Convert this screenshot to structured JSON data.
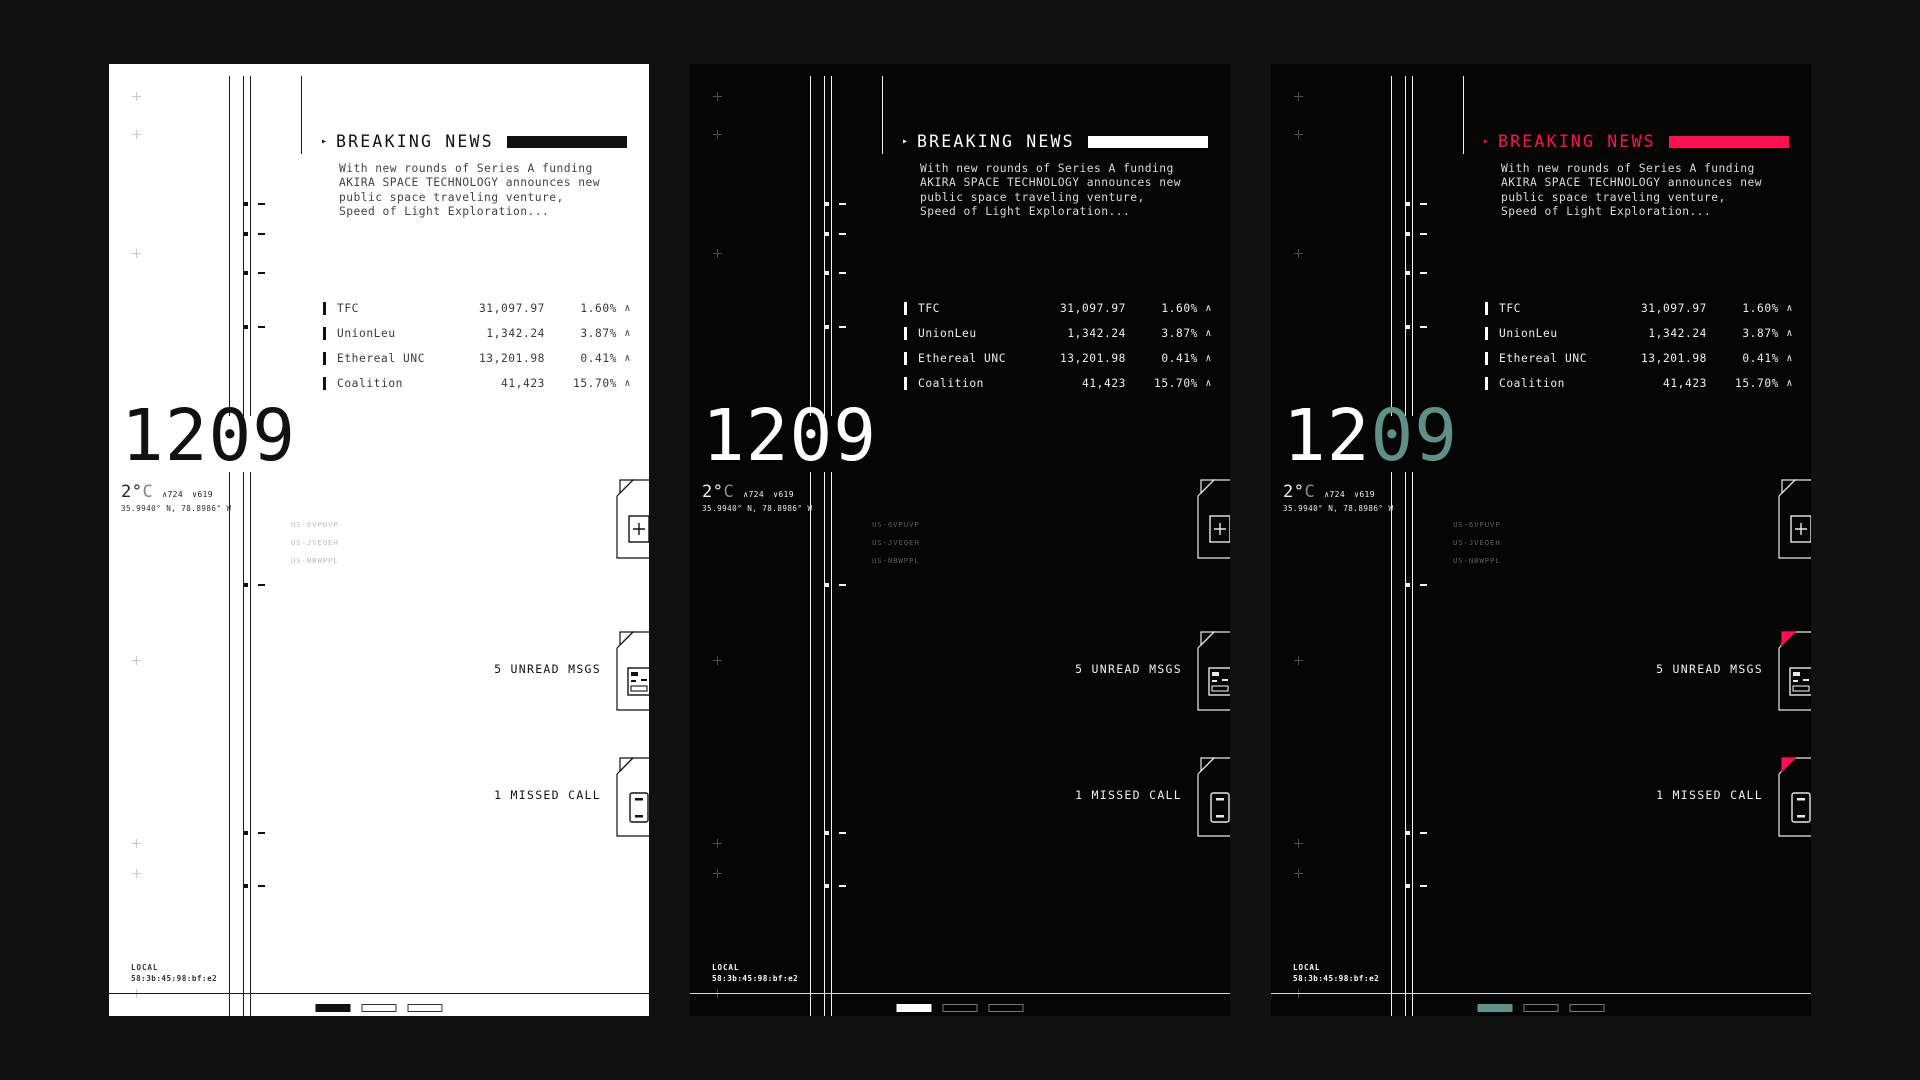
{
  "accents": {
    "light_fg": "#111111",
    "dark_bg": "#050505",
    "red": "#ff1050",
    "teal": "#5f8f85",
    "page_bg": "#111111"
  },
  "news": {
    "caret": "▸",
    "title": "BREAKING NEWS",
    "body": "With new rounds of Series A funding\nAKIRA SPACE TECHNOLOGY announces new\npublic space traveling venture,\nSpeed of Light Exploration..."
  },
  "ticker": {
    "rows": [
      {
        "name": "TFC",
        "value": "31,097.97",
        "pct": "1.60%",
        "arrow": "∧"
      },
      {
        "name": "UnionLeu",
        "value": "1,342.24",
        "pct": "3.87%",
        "arrow": "∧"
      },
      {
        "name": "Ethereal UNC",
        "value": "13,201.98",
        "pct": "0.41%",
        "arrow": "∧"
      },
      {
        "name": "Coalition",
        "value": "41,423",
        "pct": "15.70%",
        "arrow": "∧"
      }
    ]
  },
  "clock": {
    "time": "1209",
    "time_head": "12",
    "time_tail": "09",
    "temperature": "2°",
    "unit": "C",
    "high": "∧724",
    "low": "∨619",
    "coords": "35.9940° N, 78.8986° W"
  },
  "codes": [
    "US-6VPUVP",
    "US-JVEQEH",
    "US-NBWPPL"
  ],
  "cards": [
    {
      "icon": "plus-icon",
      "glyph": "+",
      "label": ""
    },
    {
      "icon": "message-icon",
      "glyph": "",
      "label": "5 UNREAD MSGS"
    },
    {
      "icon": "phone-icon",
      "glyph": "",
      "label": "1 MISSED CALL"
    }
  ],
  "footer": {
    "local_label": "LOCAL",
    "mac_address": "58:3b:45:98:bf:e2",
    "pages": [
      true,
      false,
      false
    ]
  },
  "panels": [
    {
      "theme": "light",
      "accent": "none"
    },
    {
      "theme": "dark",
      "accent": "none"
    },
    {
      "theme": "dark",
      "accent": "colored"
    }
  ]
}
